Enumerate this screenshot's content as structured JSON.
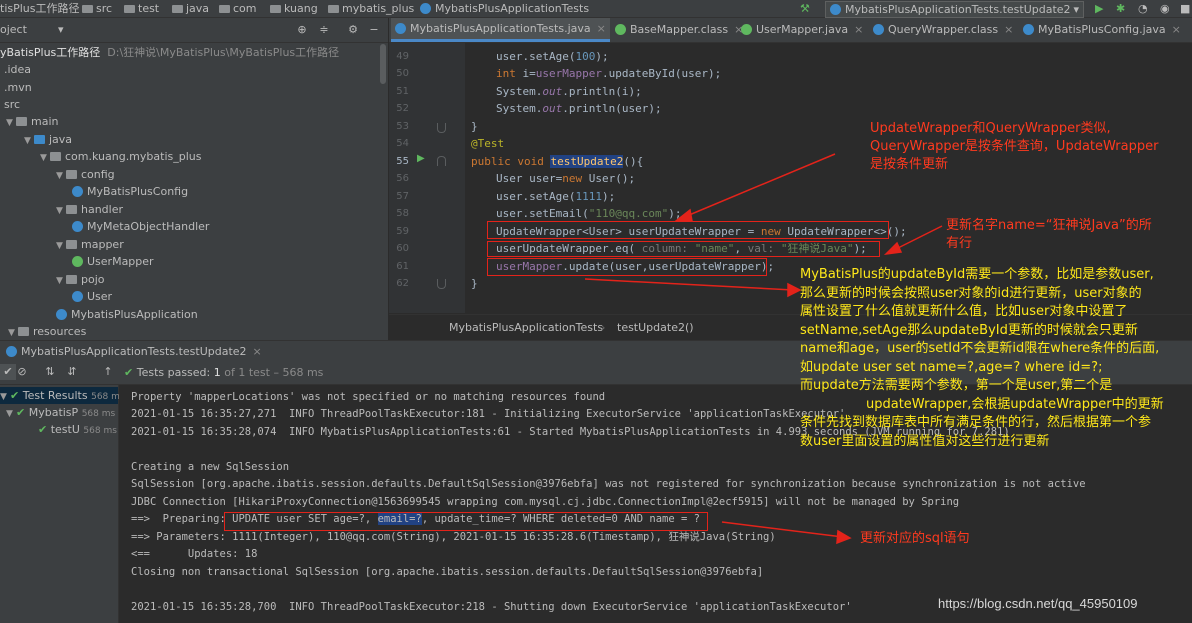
{
  "navbar": {
    "crumbs": [
      "tisPlus工作路径",
      "src",
      "test",
      "java",
      "com",
      "kuang",
      "mybatis_plus",
      "MybatisPlusApplicationTests"
    ],
    "run_config": "MybatisPlusApplicationTests.testUpdate2"
  },
  "project": {
    "header_label": "oject",
    "root_name": "yBatisPlus工作路径",
    "root_path": "D:\\狂神说\\MyBatisPlus\\MyBatisPlus工作路径",
    "items": [
      ".idea",
      ".mvn",
      "src",
      "main",
      "java",
      "com.kuang.mybatis_plus",
      "config",
      "MyBatisPlusConfig",
      "handler",
      "MyMetaObjectHandler",
      "mapper",
      "UserMapper",
      "pojo",
      "User",
      "MybatisPlusApplication",
      "resources"
    ]
  },
  "editor": {
    "tabs": [
      "MybatisPlusApplicationTests.java",
      "BaseMapper.class",
      "UserMapper.java",
      "QueryWrapper.class",
      "MyBatisPlusConfig.java"
    ],
    "line_numbers": [
      "49",
      "50",
      "51",
      "52",
      "53",
      "54",
      "55",
      "56",
      "57",
      "58",
      "59",
      "60",
      "61",
      "62"
    ],
    "breadcrumb_class": "MybatisPlusApplicationTests",
    "breadcrumb_method": "testUpdate2()",
    "code": {
      "l49_a": "user.setAge(",
      "l49_b": "100",
      "l49_c": ");",
      "l50_a": "int",
      "l50_b": " i=",
      "l50_c": "userMapper",
      "l50_d": ".updateById(user);",
      "l51_a": "System.",
      "l51_b": "out",
      "l51_c": ".println(i);",
      "l52_a": "System.",
      "l52_b": "out",
      "l52_c": ".println(user);",
      "l53": "}",
      "l54": "@Test",
      "l55_a": "public void ",
      "l55_b": "testUpdate2",
      "l55_c": "(){",
      "l56_a": "User user=",
      "l56_b": "new",
      "l56_c": " User();",
      "l57_a": "user.setAge(",
      "l57_b": "1111",
      "l57_c": ");",
      "l58_a": "user.setEmail(",
      "l58_b": "\"110@qq.com\"",
      "l58_c": ");",
      "l59_a": "UpdateWrapper<User> userUpdateWrapper = ",
      "l59_b": "new",
      "l59_c": " UpdateWrapper<>();",
      "l60_a": "userUpdateWrapper.eq(",
      "l60_h1": " column: ",
      "l60_b": "\"name\"",
      "l60_c": ",",
      "l60_h2": " val: ",
      "l60_d": "\"狂神说Java\"",
      "l60_e": ");",
      "l61_a": "userMapper",
      "l61_b": ".update(user,userUpdateWrapper);",
      "l62": "}"
    }
  },
  "run": {
    "tab_label": "MybatisPlusApplicationTests.testUpdate2",
    "status_prefix": "Tests passed: ",
    "status_count": "1",
    "status_suffix": " of 1 test – 568 ms",
    "tree": [
      {
        "label": "Test Results",
        "time": "568 ms"
      },
      {
        "label": "MybatisP",
        "time": "568 ms"
      },
      {
        "label": "testU",
        "time": "568 ms"
      }
    ],
    "console": [
      "Property 'mapperLocations' was not specified or no matching resources found",
      "2021-01-15 16:35:27,271  INFO ThreadPoolTaskExecutor:181 - Initializing ExecutorService 'applicationTaskExecutor'",
      "2021-01-15 16:35:28,074  INFO MybatisPlusApplicationTests:61 - Started MybatisPlusApplicationTests in 4.993 seconds (JVM running for 7.281)",
      "",
      "Creating a new SqlSession",
      "SqlSession [org.apache.ibatis.session.defaults.DefaultSqlSession@3976ebfa] was not registered for synchronization because synchronization is not active",
      "JDBC Connection [HikariProxyConnection@1563699545 wrapping com.mysql.cj.jdbc.ConnectionImpl@2ecf5915] will not be managed by Spring",
      "",
      "==> Parameters: 1111(Integer), 110@qq.com(String), 2021-01-15 16:35:28.6(Timestamp), 狂神说Java(String)",
      "<==      Updates: 18",
      "Closing non transactional SqlSession [org.apache.ibatis.session.defaults.DefaultSqlSession@3976ebfa]",
      "",
      "2021-01-15 16:35:28,700  INFO ThreadPoolTaskExecutor:218 - Shutting down ExecutorService 'applicationTaskExecutor'"
    ],
    "prep_prefix": "==>  Preparing: ",
    "prep_a": "UPDATE user SET age=?, ",
    "prep_b": "email=?",
    "prep_c": ", update_time=? WHERE deleted=0 AND name = ?"
  },
  "annotations": {
    "note1": [
      "UpdateWrapper和QueryWrapper类似,",
      "QueryWrapper是按条件查询，UpdateWrapper",
      "是按条件更新"
    ],
    "note2": [
      "更新名字name=“狂神说Java”的所",
      "有行"
    ],
    "note3": [
      "MyBatisPlus的updateById需要一个参数，比如是参数user,",
      "那么更新的时候会按照user对象的id进行更新，user对象的",
      "属性设置了什么值就更新什么值，比如user对象中设置了",
      "setName,setAge那么updateById更新的时候就会只更新",
      "name和age，user的setId不会更新id限在where条件的后面,",
      "如update user set name=?,age=? where id=?;",
      "而update方法需要两个参数，第一个是user,第二个是",
      "updateWrapper,会根据updateWrapper中的更新",
      "条件先找到数据库表中所有满足条件的行，然后根据第一个参",
      "数user里面设置的属性值对这些行进行更新"
    ],
    "note4": "更新对应的sql语句",
    "watermark": "https://blog.csdn.net/qq_45950109"
  },
  "colors": {
    "accent": "#4a88c7",
    "annotation_red": "#ff3a1f",
    "annotation_yellow": "#ffe81a",
    "pass_green": "#5fb85f"
  }
}
